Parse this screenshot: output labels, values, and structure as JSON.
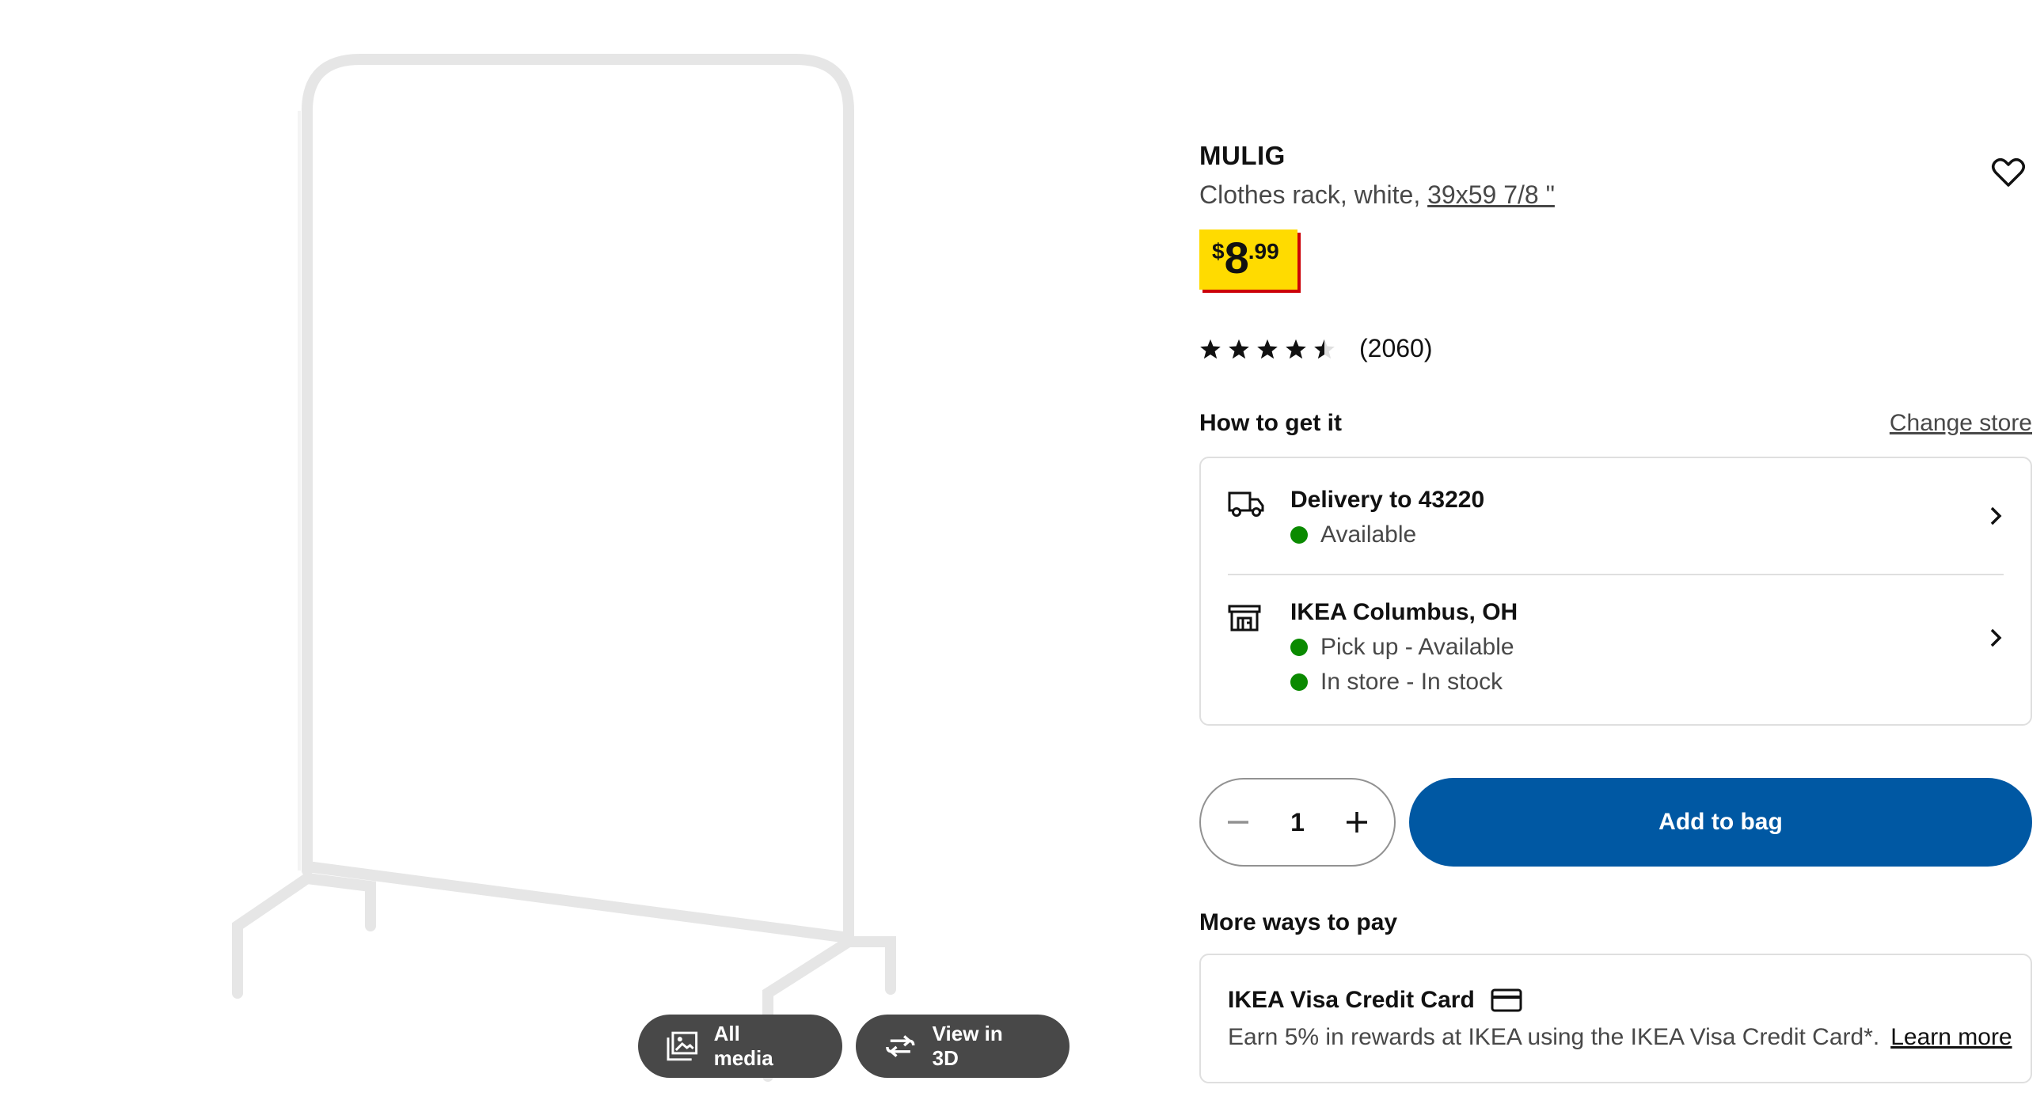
{
  "media": {
    "all_media_label": "All media",
    "view_3d_label": "View in 3D",
    "image_icon": "gallery-icon",
    "rotate_icon": "rotate-3d-icon"
  },
  "product": {
    "name": "MULIG",
    "description": "Clothes rack, white, ",
    "size": "39x59 7/8 \"",
    "price": {
      "currency": "$",
      "integer": "8",
      "decimal": ".99"
    },
    "rating_stars": 4.5,
    "rating_count": "(2060)",
    "favorite_icon": "heart-icon"
  },
  "availability": {
    "title": "How to get it",
    "change_store": "Change store",
    "delivery": {
      "title": "Delivery to 43220",
      "status": "Available",
      "icon": "truck-icon"
    },
    "store": {
      "title": "IKEA Columbus, OH",
      "status_pickup": "Pick up - Available",
      "status_instore": "In store - In stock",
      "icon": "store-icon"
    },
    "status_color": "#0a8a00"
  },
  "purchase": {
    "quantity": "1",
    "add_to_bag": "Add to bag",
    "accent_color": "#0058a3"
  },
  "payment": {
    "title": "More ways to pay",
    "card_title": "IKEA Visa Credit Card",
    "card_desc": "Earn 5% in rewards at IKEA using the IKEA Visa Credit Card*.",
    "learn_more": "Learn more",
    "card_icon": "credit-card-icon"
  }
}
